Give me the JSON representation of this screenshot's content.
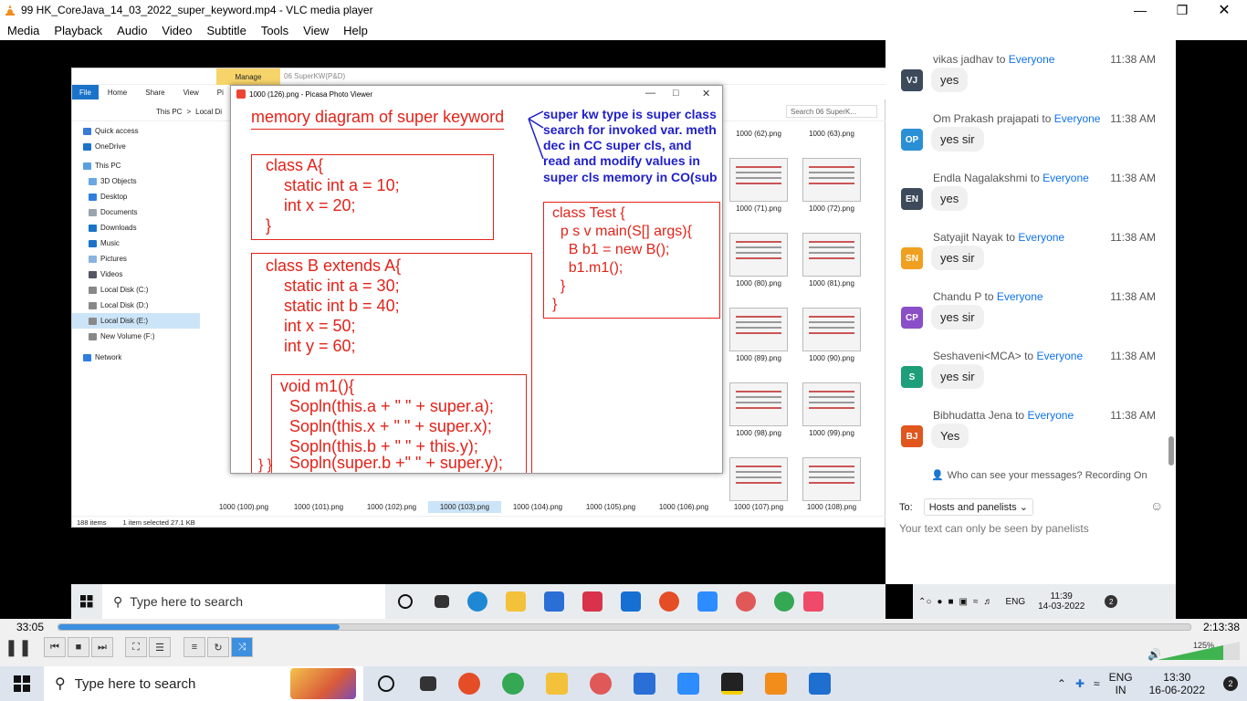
{
  "vlc": {
    "title": "99 HK_CoreJava_14_03_2022_super_keyword.mp4 - VLC media player",
    "menu": [
      "Media",
      "Playback",
      "Audio",
      "Video",
      "Subtitle",
      "Tools",
      "View",
      "Help"
    ],
    "time_current": "33:05",
    "time_total": "2:13:38",
    "progress": 0.248,
    "volume_label": "125%"
  },
  "explorer": {
    "manage_tab": "Manage",
    "window_title": "06 SuperKW(P&D)",
    "ribbon": [
      "File",
      "Home",
      "Share",
      "View",
      "Pi"
    ],
    "breadcrumb": [
      "This PC",
      ">",
      "Local Di"
    ],
    "search_placeholder": "Search 06 SuperK...",
    "nav": [
      "Quick access",
      "OneDrive",
      "This PC",
      "3D Objects",
      "Desktop",
      "Documents",
      "Downloads",
      "Music",
      "Pictures",
      "Videos",
      "Local Disk (C:)",
      "Local Disk (D:)",
      "Local Disk (E:)",
      "New Volume (F:)",
      "Network"
    ],
    "thumb_labels_right": [
      "1000 (62).png",
      "1000 (63).png",
      "1000 (71).png",
      "1000 (72).png",
      "1000 (80).png",
      "1000 (81).png",
      "1000 (89).png",
      "1000 (90).png",
      "1000 (98).png",
      "1000 (99).png",
      "1000 (107).png",
      "1000 (108).png"
    ],
    "bottom_labels": [
      "1000 (100).png",
      "1000 (101).png",
      "1000 (102).png",
      "1000 (103).png",
      "1000 (104).png",
      "1000 (105).png",
      "1000 (106).png"
    ],
    "status_items": "188 items",
    "status_selected": "1 item selected  27.1 KB"
  },
  "picasa": {
    "title": "1000 (126).png - Picasa Photo Viewer"
  },
  "slide": {
    "title": "memory diagram of super keyword",
    "note": [
      "super kw type is super class",
      "search for invoked var. meth",
      "dec in CC super cls, and",
      "read and modify values in",
      "super cls memory in CO(sub"
    ],
    "class_a": [
      "class A{",
      "    static int a = 10;",
      "    int x = 20;",
      "}"
    ],
    "class_b": [
      "class B extends A{",
      "    static int a = 30;",
      "    static int b = 40;",
      "    int x = 50;",
      "    int y = 60;"
    ],
    "m1": [
      "void m1(){",
      "  Sopln(this.a + \" \" + super.a);",
      "  Sopln(this.x + \" \" + super.x);",
      "  Sopln(this.b + \" \" + this.y);",
      "  Sopln(super.b +\" \" + super.y);"
    ],
    "m1_close": "} }",
    "test": [
      "class Test {",
      "  p s v main(S[] args){",
      "    B b1 = new B();",
      "    b1.m1();",
      "  }",
      "}"
    ]
  },
  "chat": {
    "messages": [
      {
        "sender": "vikas jadhav",
        "initials": "VJ",
        "color": "#3c4a5c",
        "time": "11:38 AM",
        "text": "yes"
      },
      {
        "sender": "Om Prakash prajapati",
        "initials": "OP",
        "color": "#2b8fd6",
        "time": "11:38 AM",
        "text": "yes sir"
      },
      {
        "sender": "Endla Nagalakshmi",
        "initials": "EN",
        "color": "#3c4a5c",
        "time": "11:38 AM",
        "text": "yes"
      },
      {
        "sender": "Satyajit Nayak",
        "initials": "SN",
        "color": "#f0a020",
        "time": "11:38 AM",
        "text": "yes sir"
      },
      {
        "sender": "Chandu P",
        "initials": "CP",
        "color": "#8a4fc8",
        "time": "11:38 AM",
        "text": "yes sir"
      },
      {
        "sender": "Seshaveni<MCA>",
        "initials": "S",
        "color": "#1e9e7a",
        "time": "11:38 AM",
        "text": "yes sir"
      },
      {
        "sender": "Bibhudatta Jena",
        "initials": "BJ",
        "color": "#e0561e",
        "time": "11:38 AM",
        "text": "Yes"
      }
    ],
    "to_word": "to",
    "everyone": "Everyone",
    "who_can_see": "Who can see your messages? Recording On",
    "to_label": "To:",
    "to_value": "Hosts and panelists",
    "hint": "Your text can only be seen by panelists"
  },
  "rec_taskbar": {
    "search": "Type here to search",
    "lang": "ENG",
    "time": "11:39",
    "date": "14-03-2022",
    "notif": "2"
  },
  "taskbar": {
    "search": "Type here to search",
    "lang": "ENG",
    "region": "IN",
    "time": "13:30",
    "date": "16-06-2022",
    "notif": "2"
  }
}
